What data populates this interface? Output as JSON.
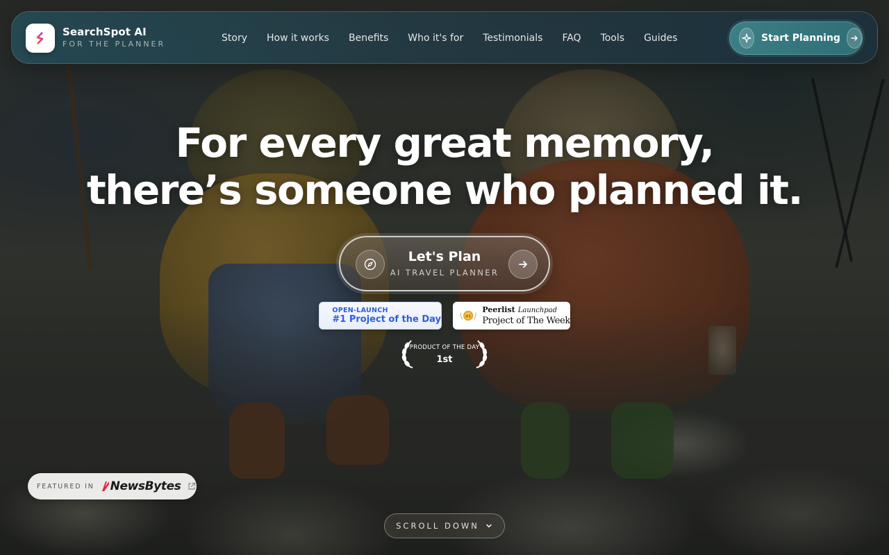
{
  "brand": {
    "name": "SearchSpot AI",
    "tagline": "FOR THE PLANNER"
  },
  "nav": {
    "links": [
      "Story",
      "How it works",
      "Benefits",
      "Who it's for",
      "Testimonials",
      "FAQ",
      "Tools",
      "Guides"
    ],
    "cta_label": "Start Planning"
  },
  "hero": {
    "title_line1": "For every great memory,",
    "title_line2": "there’s someone who planned it.",
    "plan_button": {
      "label": "Let's Plan",
      "sublabel": "AI TRAVEL PLANNER"
    }
  },
  "badges": {
    "open_launch": {
      "small": "OPEN-LAUNCH",
      "big": "#1 Project of the Day"
    },
    "peerlist": {
      "brand": "Peerlist",
      "sub": "Launchpad",
      "title": "Project of The Week",
      "medal_text": "#1"
    },
    "product_of_day": {
      "label": "PRODUCT OF THE DAY",
      "rank": "1st"
    }
  },
  "featured": {
    "prefix": "FEATURED IN",
    "outlet": "NewsBytes"
  },
  "scroll": {
    "label": "SCROLL DOWN"
  },
  "colors": {
    "nav_bg": "#2a5564",
    "cta_bg": "#3b7f86",
    "logo_accent": "#e0407a",
    "open_launch_blue": "#2d5fd6"
  },
  "icons": {
    "logo": "searchspot-logo-icon",
    "cta_left": "sparkle-icon",
    "cta_right": "arrow-right-icon",
    "plan_left": "compass-icon",
    "plan_right": "arrow-right-icon",
    "open_launch": "award-ribbon-icon",
    "peerlist": "medal-icon",
    "featured_ext": "external-link-icon",
    "scroll": "chevron-down-icon"
  }
}
